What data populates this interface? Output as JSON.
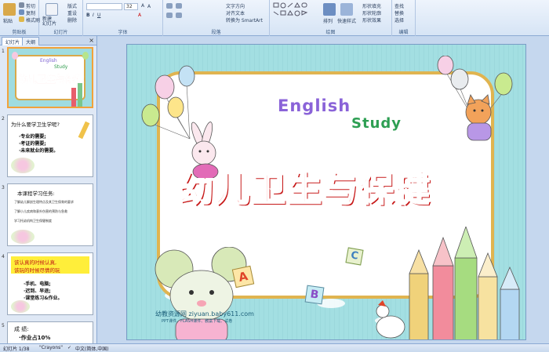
{
  "ribbon": {
    "clipboard": {
      "label": "剪贴板",
      "paste": "粘贴",
      "cut": "剪切",
      "copy": "复制",
      "format": "格式刷"
    },
    "slides": {
      "label": "幻灯片",
      "new_slide": "新建\n幻灯片",
      "layout": "版式",
      "reset": "重设",
      "delete": "删除"
    },
    "font": {
      "label": "字体",
      "font_size": "32"
    },
    "paragraph": {
      "label": "段落",
      "text_direction": "文字方向",
      "align_text": "对齐文本",
      "smartart": "转换为 SmartArt"
    },
    "drawing": {
      "label": "绘图",
      "arrange": "排列",
      "quick_styles": "快速样式",
      "shape_fill": "形状填充",
      "shape_outline": "形状轮廓",
      "shape_effects": "形状效果"
    },
    "editing": {
      "label": "编辑",
      "find": "查找",
      "replace": "替换",
      "select": "选择"
    }
  },
  "panel": {
    "tabs": [
      "幻灯片",
      "大纲"
    ],
    "close": "×"
  },
  "thumbnails": [
    {
      "num": "1",
      "title": "幼儿卫生与保健",
      "english": "English",
      "study": "Study"
    },
    {
      "num": "2",
      "heading": "为什么要学卫生学呢?",
      "lines": [
        "·专业的需要;",
        "·考证的需要;",
        "·未来就业的需要。"
      ]
    },
    {
      "num": "3",
      "heading": "本课程学习任务:",
      "lines": [
        "了解幼儿解剖生理特点及其卫生保育的要求",
        "了解小儿疾病和意外伤害的预防与急救",
        "学习托幼机构卫生保健制度"
      ]
    },
    {
      "num": "4",
      "heading1": "该认真的时候认真,",
      "heading2": "该玩的时候尽情的玩",
      "lines": [
        "·手机、电脑;",
        "·迟到、早退;",
        "·课堂练习&作业。"
      ]
    },
    {
      "num": "5",
      "heading": "成 绩:",
      "lines": [
        "·作业占10%"
      ]
    }
  ],
  "slide": {
    "title": "幼儿卫生与保健",
    "english": "English",
    "study": "Study",
    "watermark": "幼教资源网 ziyuan.baby611.com",
    "watermark_sub": "PPT课件、FLASH课件、教案下载、试卷",
    "block_a": "A",
    "block_b": "B",
    "block_c": "C"
  },
  "status": {
    "slide_info": "幻灯片 1/38",
    "theme": "\"Crayons\"",
    "language": "中文(简体,中国)"
  }
}
